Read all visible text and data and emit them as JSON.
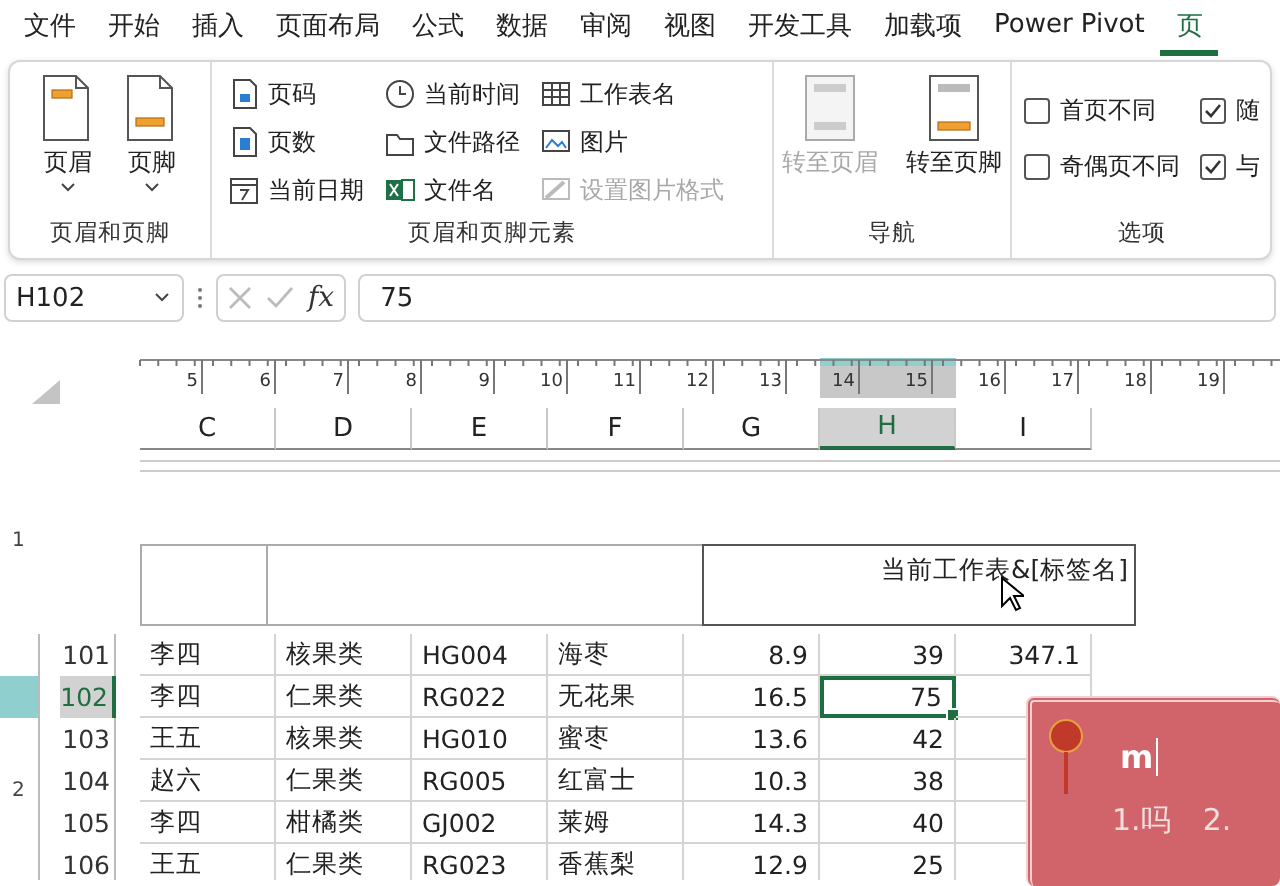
{
  "menu_tabs": [
    {
      "label": "文件",
      "selected": false
    },
    {
      "label": "开始",
      "selected": false
    },
    {
      "label": "插入",
      "selected": false
    },
    {
      "label": "页面布局",
      "selected": false
    },
    {
      "label": "公式",
      "selected": false
    },
    {
      "label": "数据",
      "selected": false
    },
    {
      "label": "审阅",
      "selected": false
    },
    {
      "label": "视图",
      "selected": false
    },
    {
      "label": "开发工具",
      "selected": false
    },
    {
      "label": "加载项",
      "selected": false
    },
    {
      "label": "Power Pivot",
      "selected": false
    },
    {
      "label": "页",
      "selected": true
    }
  ],
  "ribbon": {
    "groups": [
      {
        "label": "页眉和页脚",
        "buttons": [
          {
            "kind": "large",
            "label": "页眉",
            "dropdown": true,
            "disabled": false
          },
          {
            "kind": "large",
            "label": "页脚",
            "dropdown": true,
            "disabled": false
          }
        ]
      },
      {
        "label": "页眉和页脚元素",
        "buttons": [
          {
            "kind": "small",
            "label": "页码",
            "disabled": false
          },
          {
            "kind": "small",
            "label": "页数",
            "disabled": false
          },
          {
            "kind": "small",
            "label": "当前日期",
            "disabled": false
          },
          {
            "kind": "small",
            "label": "当前时间",
            "disabled": false
          },
          {
            "kind": "small",
            "label": "文件路径",
            "disabled": false
          },
          {
            "kind": "small",
            "label": "文件名",
            "disabled": false
          },
          {
            "kind": "small",
            "label": "工作表名",
            "disabled": false
          },
          {
            "kind": "small",
            "label": "图片",
            "disabled": false
          },
          {
            "kind": "small",
            "label": "设置图片格式",
            "disabled": true
          }
        ]
      },
      {
        "label": "导航",
        "buttons": [
          {
            "kind": "large",
            "label": "转至页眉",
            "dropdown": false,
            "disabled": true
          },
          {
            "kind": "large",
            "label": "转至页脚",
            "dropdown": false,
            "disabled": false
          }
        ]
      },
      {
        "label": "选项",
        "buttons": [
          {
            "kind": "checkbox",
            "label": "首页不同",
            "checked": false
          },
          {
            "kind": "checkbox",
            "label": "奇偶页不同",
            "checked": false
          },
          {
            "kind": "checkbox",
            "label": "随",
            "checked": true
          },
          {
            "kind": "checkbox",
            "label": "与",
            "checked": true
          }
        ]
      }
    ]
  },
  "formula_bar": {
    "name_box": "H102",
    "function_label": "fx",
    "formula": "75"
  },
  "sheet": {
    "ruler": {
      "labels": [
        "5",
        "6",
        "7",
        "8",
        "9",
        "10",
        "11",
        "12",
        "13",
        "14",
        "15",
        "16",
        "17",
        "18",
        "19"
      ]
    },
    "vertical_ruler": {
      "labels": [
        "1",
        "2"
      ]
    },
    "columns": [
      {
        "label": "C",
        "kind": "text",
        "selected": false
      },
      {
        "label": "D",
        "kind": "text",
        "selected": false
      },
      {
        "label": "E",
        "kind": "text",
        "selected": false
      },
      {
        "label": "F",
        "kind": "text",
        "selected": false
      },
      {
        "label": "G",
        "kind": "number",
        "selected": false
      },
      {
        "label": "H",
        "kind": "number",
        "selected": true
      },
      {
        "label": "I",
        "kind": "number",
        "selected": false
      }
    ],
    "page_header": {
      "right_text": "当前工作表&[标签名]"
    },
    "rows": [
      {
        "number": "101",
        "selected": false,
        "cells": [
          "李四",
          "核果类",
          "HG004",
          "海枣",
          "8.9",
          "39",
          "347.1"
        ]
      },
      {
        "number": "102",
        "selected": true,
        "cells": [
          "李四",
          "仁果类",
          "RG022",
          "无花果",
          "16.5",
          "75"
        ]
      },
      {
        "number": "103",
        "selected": false,
        "cells": [
          "王五",
          "核果类",
          "HG010",
          "蜜枣",
          "13.6",
          "42"
        ]
      },
      {
        "number": "104",
        "selected": false,
        "cells": [
          "赵六",
          "仁果类",
          "RG005",
          "红富士",
          "10.3",
          "38"
        ]
      },
      {
        "number": "105",
        "selected": false,
        "cells": [
          "李四",
          "柑橘类",
          "GJ002",
          "莱姆",
          "14.3",
          "40"
        ]
      },
      {
        "number": "106",
        "selected": false,
        "cells": [
          "王五",
          "仁果类",
          "RG023",
          "香蕉梨",
          "12.9",
          "25"
        ]
      }
    ]
  },
  "ime": {
    "input": "m",
    "candidates": [
      "1.吗",
      "2."
    ]
  }
}
